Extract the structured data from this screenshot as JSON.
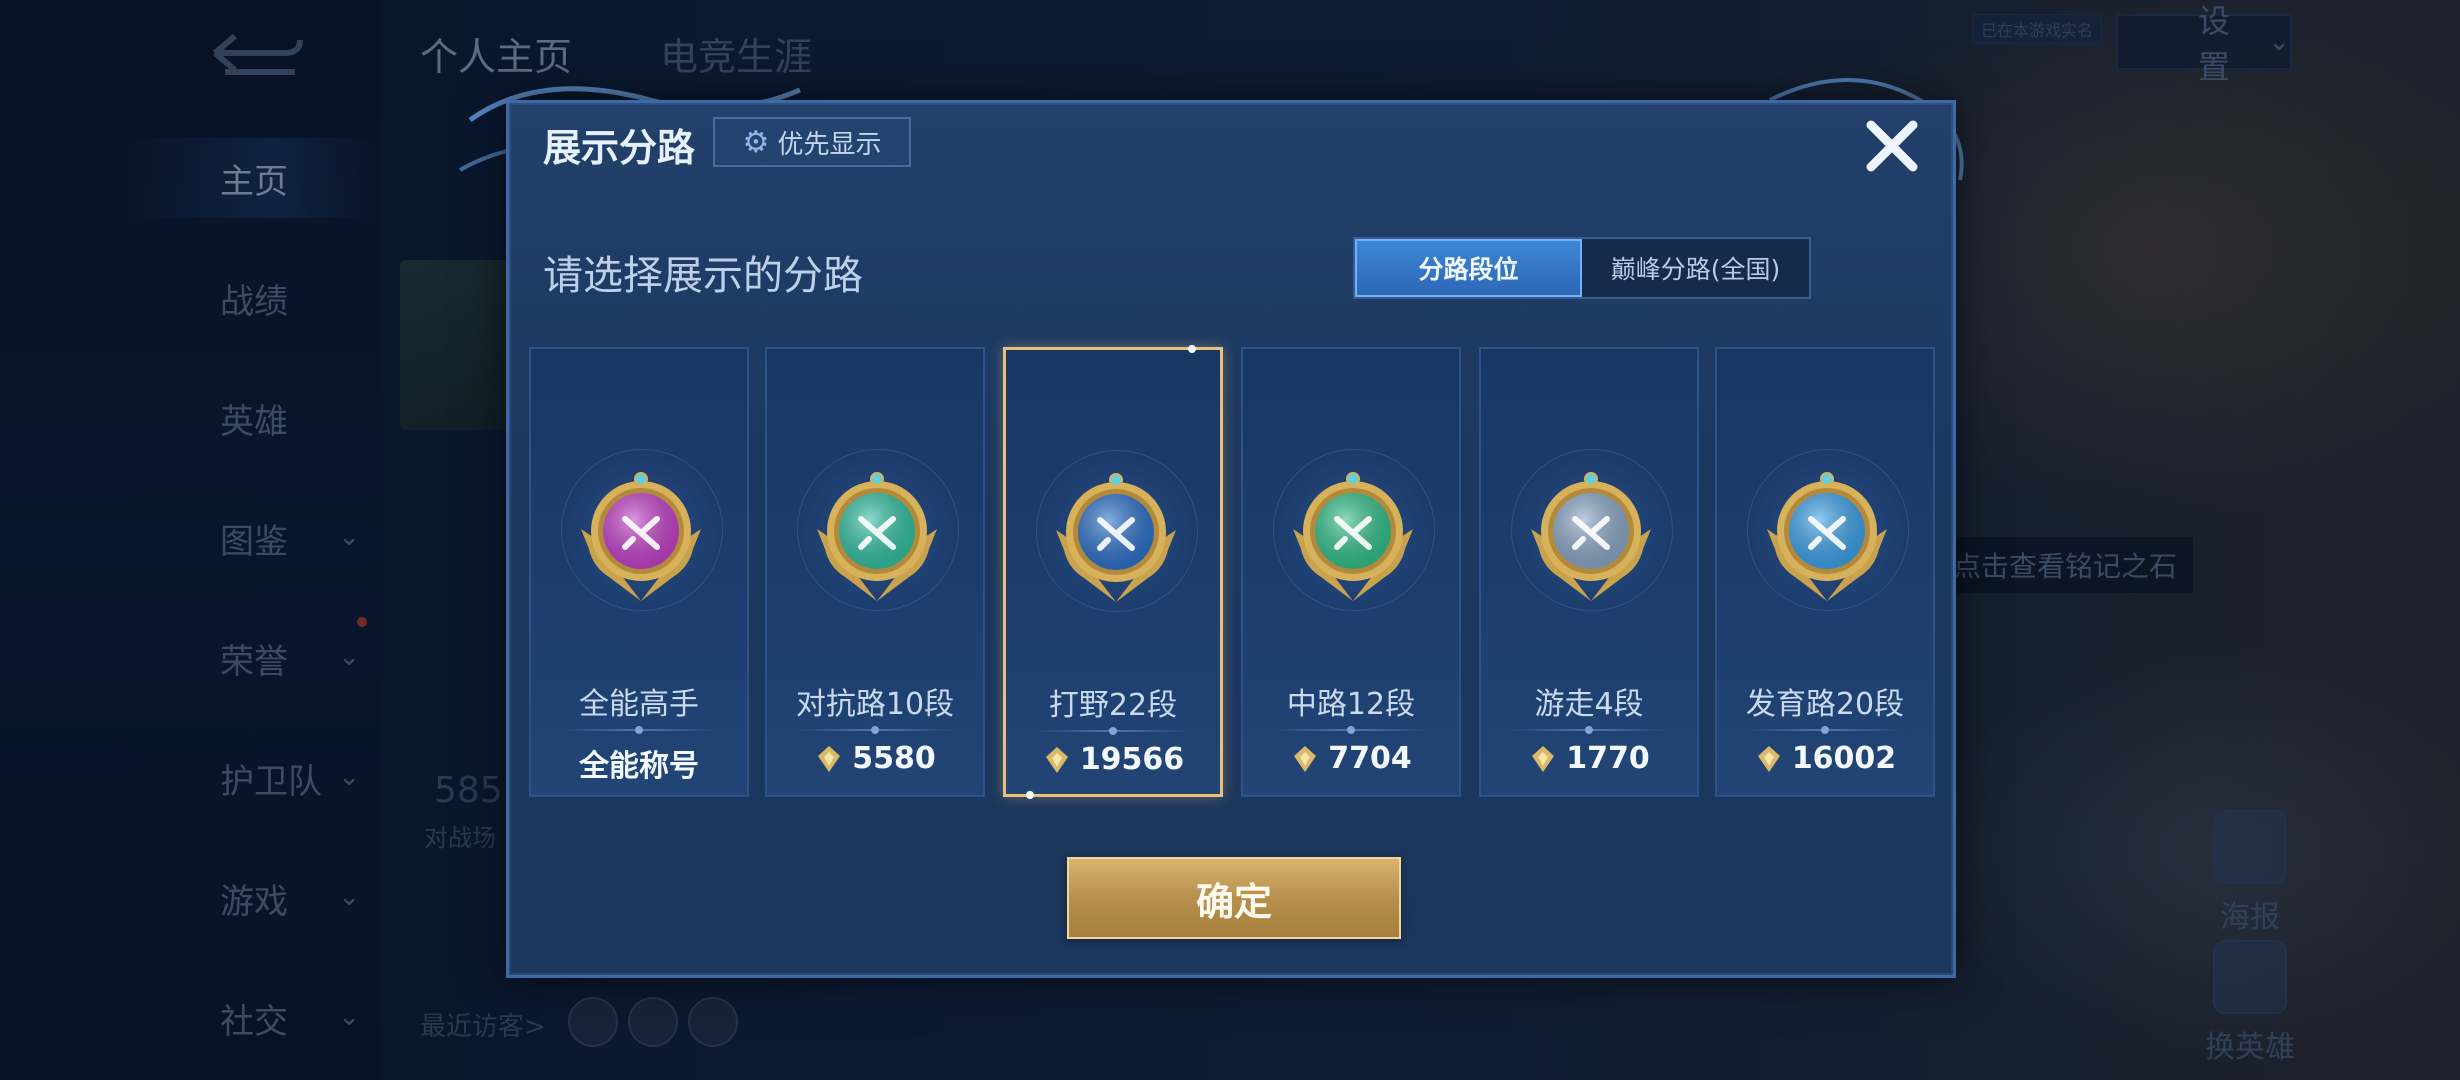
{
  "background": {
    "sidebar_items": [
      {
        "label": "主页",
        "active": true
      },
      {
        "label": "战绩"
      },
      {
        "label": "英雄"
      },
      {
        "label": "图鉴",
        "chevron": "⌄"
      },
      {
        "label": "荣誉",
        "chevron": "⌄"
      },
      {
        "label": "护卫队",
        "chevron": "⌄"
      },
      {
        "label": "游戏",
        "chevron": "⌄"
      },
      {
        "label": "社交",
        "chevron": "⌄"
      }
    ],
    "tabs": [
      "个人主页",
      "电竞生涯"
    ],
    "settings_label": "设置",
    "settings_small": "已在本游戏实名",
    "stat_value": "585",
    "stat_label": "对战场",
    "visitors_label": "最近访客>",
    "rune_hint": "点击查看铭记之石",
    "right_buttons": [
      "海报",
      "换英雄"
    ]
  },
  "dialog": {
    "title": "展示分路",
    "priority_button": "优先显示",
    "subtitle": "请选择展示的分路",
    "toggle": [
      "分路段位",
      "巅峰分路(全国)"
    ],
    "selected_toggle": 0,
    "confirm_label": "确定",
    "colors": {
      "accent_gold": "#e9c079",
      "toggle_blue": "#3f87d8"
    },
    "cards": [
      {
        "name": "全能高手",
        "value": "全能称号",
        "icon": "all-round-emblem-icon",
        "color": "#c23fc9",
        "has_score_icon": false
      },
      {
        "name": "对抗路10段",
        "value": "5580",
        "icon": "clash-lane-emblem-icon",
        "color": "#2fbfa0",
        "has_score_icon": true
      },
      {
        "name": "打野22段",
        "value": "19566",
        "icon": "jungle-emblem-icon",
        "color": "#2a6fc9",
        "has_score_icon": true,
        "selected": true
      },
      {
        "name": "中路12段",
        "value": "7704",
        "icon": "mid-lane-emblem-icon",
        "color": "#2fbf8a",
        "has_score_icon": true
      },
      {
        "name": "游走4段",
        "value": "1770",
        "icon": "roam-emblem-icon",
        "color": "#8aa6c6",
        "has_score_icon": true
      },
      {
        "name": "发育路20段",
        "value": "16002",
        "icon": "farm-lane-emblem-icon",
        "color": "#3aa0e8",
        "has_score_icon": true
      }
    ]
  }
}
